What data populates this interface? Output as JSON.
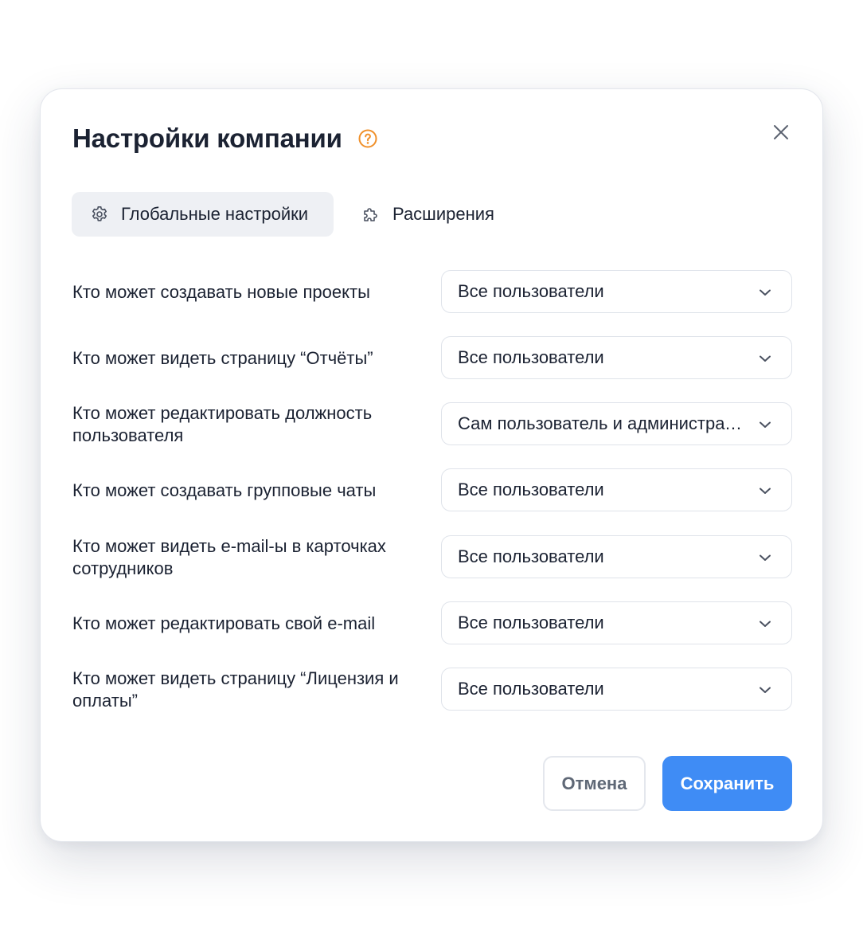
{
  "modal": {
    "title": "Настройки компании",
    "help_icon": "question-circle-icon",
    "close_icon": "close-icon"
  },
  "tabs": [
    {
      "label": "Глобальные настройки",
      "icon": "gear-icon",
      "active": true
    },
    {
      "label": "Расширения",
      "icon": "puzzle-icon",
      "active": false
    }
  ],
  "settings": [
    {
      "label": "Кто может создавать новые проекты",
      "value": "Все пользователи"
    },
    {
      "label": "Кто может видеть страницу “Отчёты”",
      "value": "Все пользователи"
    },
    {
      "label": "Кто может редактировать должность пользователя",
      "value": "Сам пользователь и администратор"
    },
    {
      "label": "Кто может создавать групповые чаты",
      "value": "Все пользователи"
    },
    {
      "label": "Кто может видеть e-mail-ы в карточках сотрудников",
      "value": "Все пользователи"
    },
    {
      "label": "Кто может редактировать свой e-mail",
      "value": "Все пользователи"
    },
    {
      "label": "Кто может видеть страницу “Лицензия и оплаты”",
      "value": "Все пользователи"
    }
  ],
  "footer": {
    "cancel_label": "Отмена",
    "save_label": "Сохранить"
  },
  "colors": {
    "accent": "#3f8cf5",
    "help_icon": "#f0902a",
    "text": "#1b2232",
    "active_tab_bg": "#eef0f4"
  }
}
